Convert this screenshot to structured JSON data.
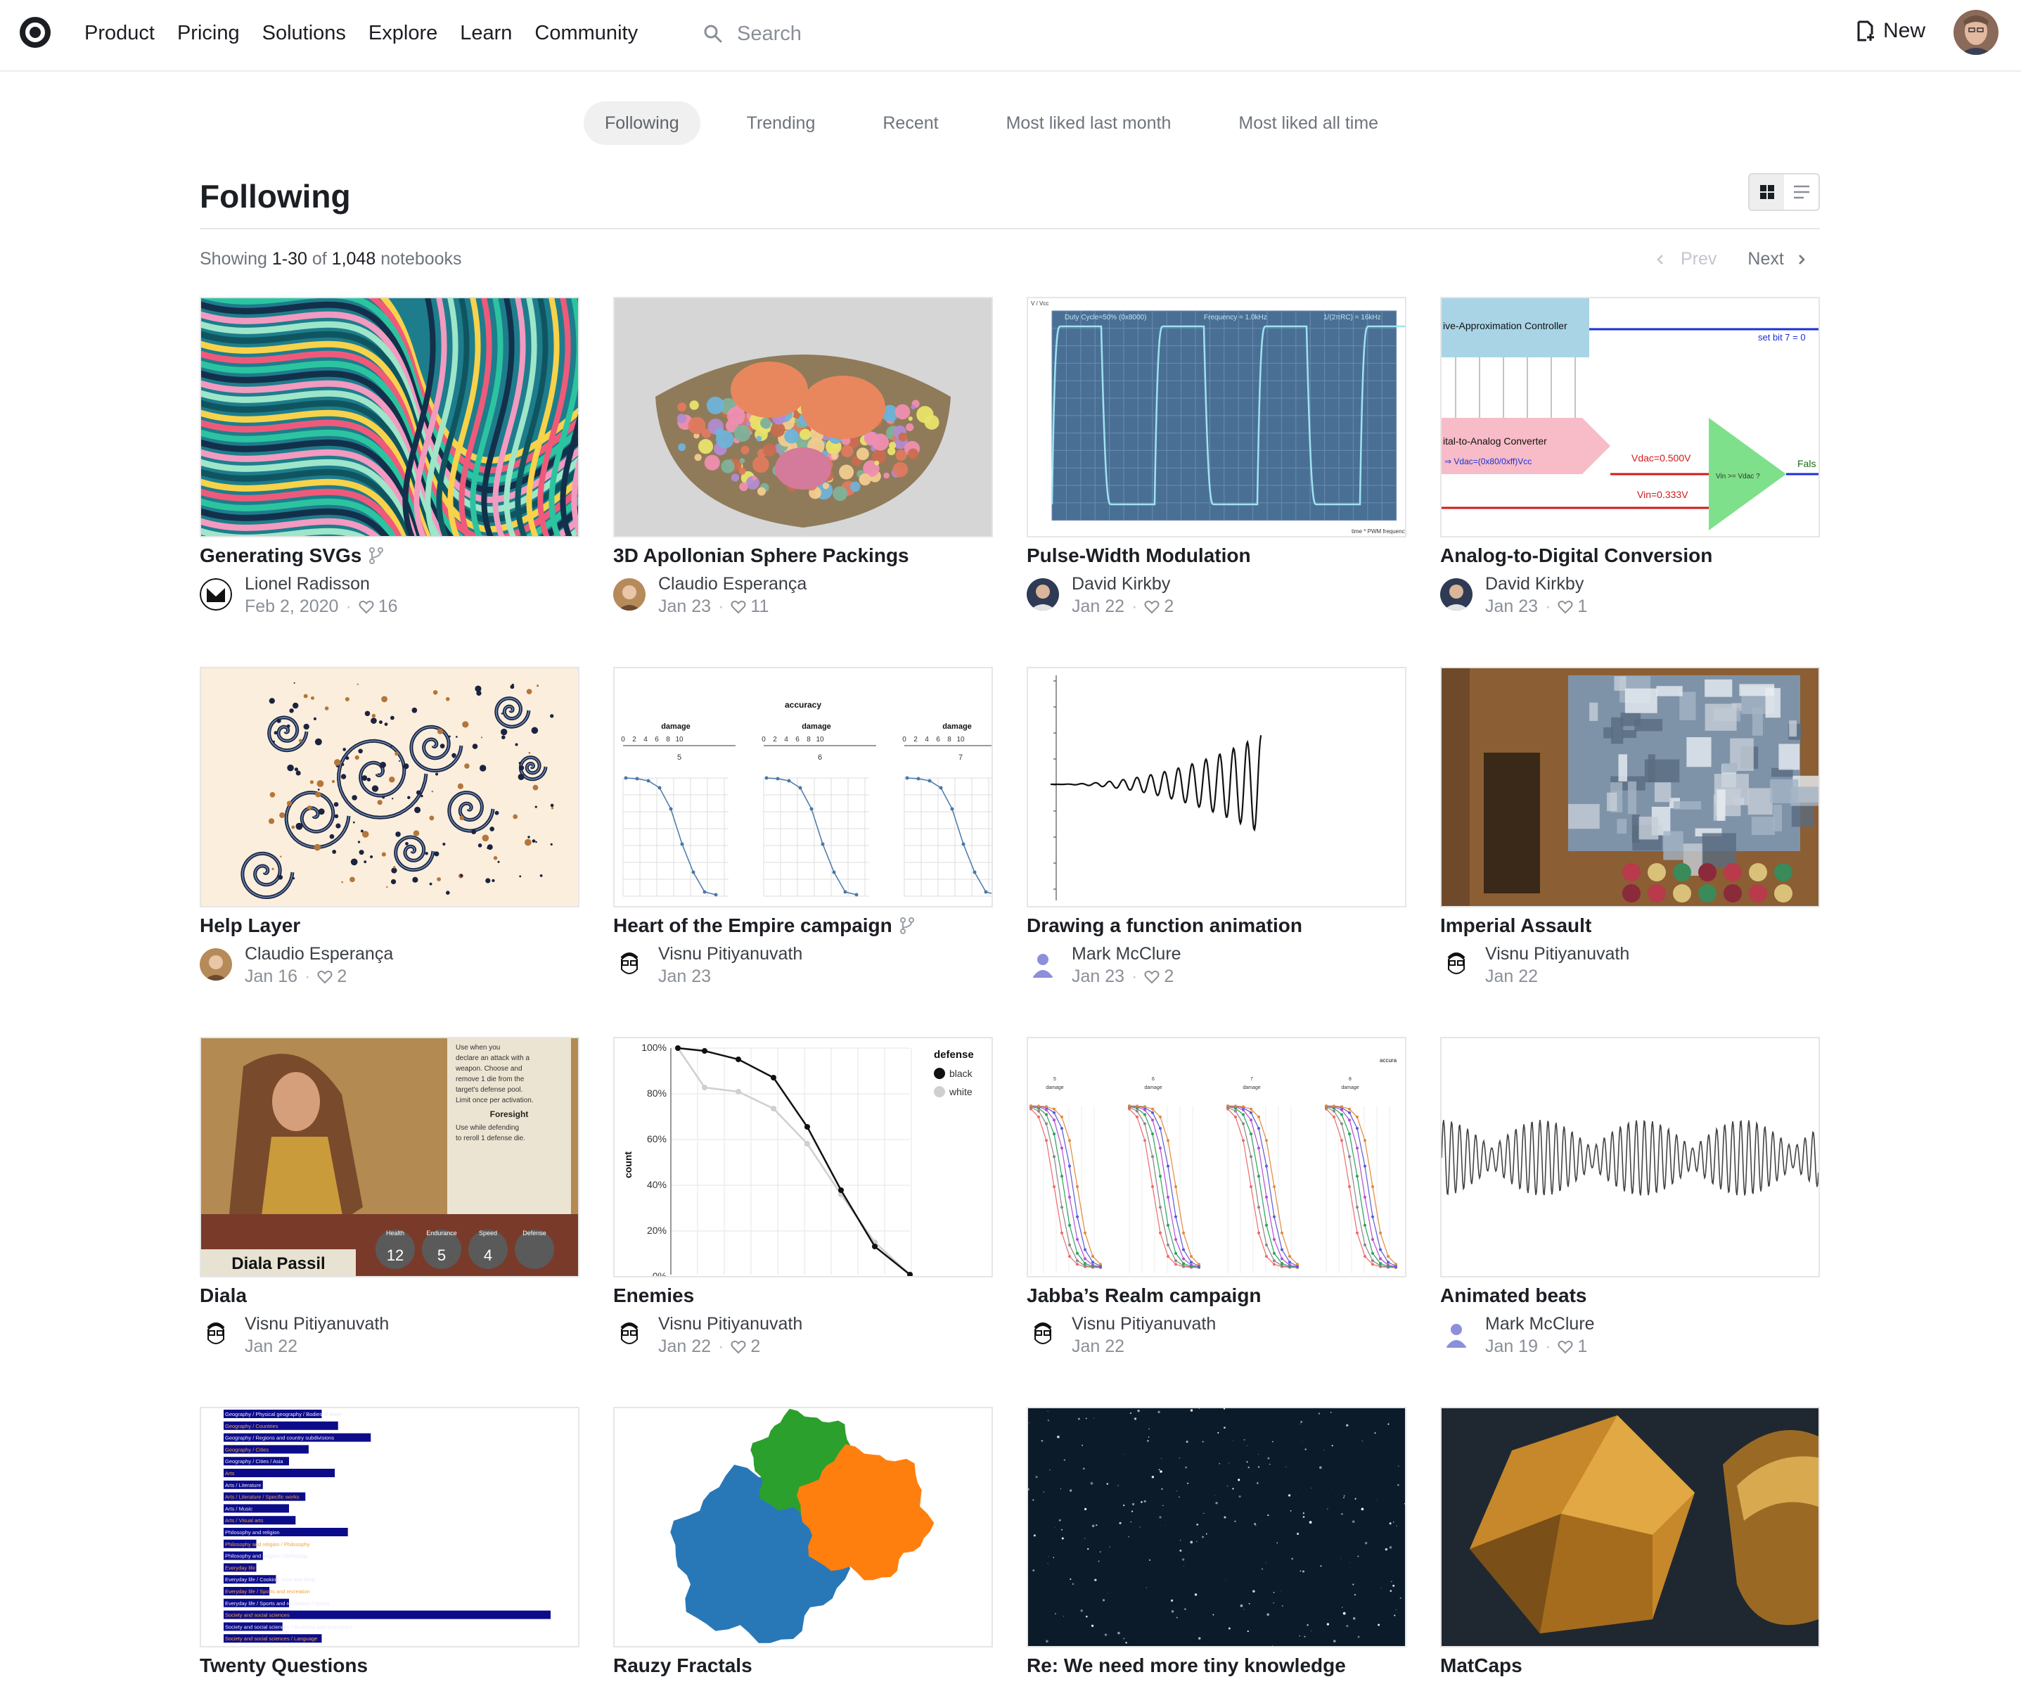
{
  "nav": {
    "items": [
      "Product",
      "Pricing",
      "Solutions",
      "Explore",
      "Learn",
      "Community"
    ],
    "search_placeholder": "Search",
    "new_label": "New"
  },
  "tabs": [
    "Following",
    "Trending",
    "Recent",
    "Most liked last month",
    "Most liked all time"
  ],
  "active_tab": "Following",
  "page_title": "Following",
  "showing": {
    "prefix": "Showing",
    "range": "1-30",
    "of": "of",
    "total": "1,048",
    "suffix": "notebooks"
  },
  "pager": {
    "prev": "Prev",
    "next": "Next"
  },
  "colors": {
    "accent": "#1b1e23",
    "muted": "#8a8f98",
    "thumb_border": "#e6e6e6"
  },
  "notebooks": [
    {
      "title": "Generating SVGs",
      "fork": true,
      "author": "Lionel Radisson",
      "date": "Feb 2, 2020",
      "likes": "16",
      "thumb": "swirl-art"
    },
    {
      "title": "3D Apollonian Sphere Packings",
      "fork": false,
      "author": "Claudio Esperança",
      "date": "Jan 23",
      "likes": "11",
      "thumb": "sphere-bowl"
    },
    {
      "title": "Pulse-Width Modulation",
      "fork": false,
      "author": "David Kirkby",
      "date": "Jan 22",
      "likes": "2",
      "thumb": "pwm-chart"
    },
    {
      "title": "Analog-to-Digital Conversion",
      "fork": false,
      "author": "David Kirkby",
      "date": "Jan 23",
      "likes": "1",
      "thumb": "adc-diagram"
    },
    {
      "title": "Help Layer",
      "fork": false,
      "author": "Claudio Esperança",
      "date": "Jan 16",
      "likes": "2",
      "thumb": "fractal-spiral"
    },
    {
      "title": "Heart of the Empire campaign",
      "fork": true,
      "author": "Visnu Pitiyanuvath",
      "date": "Jan 23",
      "likes": "",
      "thumb": "accuracy-curves"
    },
    {
      "title": "Drawing a function animation",
      "fork": false,
      "author": "Mark McClure",
      "date": "Jan 23",
      "likes": "2",
      "thumb": "wave-function"
    },
    {
      "title": "Imperial Assault",
      "fork": false,
      "author": "Visnu Pitiyanuvath",
      "date": "Jan 22",
      "likes": "",
      "thumb": "board-game"
    },
    {
      "title": "Diala",
      "fork": false,
      "author": "Visnu Pitiyanuvath",
      "date": "Jan 22",
      "likes": "",
      "thumb": "game-card"
    },
    {
      "title": "Enemies",
      "fork": false,
      "author": "Visnu Pitiyanuvath",
      "date": "Jan 22",
      "likes": "2",
      "thumb": "defense-chart"
    },
    {
      "title": "Jabba’s Realm campaign",
      "fork": false,
      "author": "Visnu Pitiyanuvath",
      "date": "Jan 22",
      "likes": "",
      "thumb": "multi-curves"
    },
    {
      "title": "Animated beats",
      "fork": false,
      "author": "Mark McClure",
      "date": "Jan 19",
      "likes": "1",
      "thumb": "beats-wave"
    },
    {
      "title": "Twenty Questions",
      "fork": false,
      "author": "",
      "date": "",
      "likes": "",
      "thumb": "bar-list"
    },
    {
      "title": "Rauzy Fractals",
      "fork": false,
      "author": "",
      "date": "",
      "likes": "",
      "thumb": "rauzy-fractal"
    },
    {
      "title": "Re: We need more tiny knowledge",
      "fork": false,
      "author": "",
      "date": "",
      "likes": "",
      "thumb": "starfield"
    },
    {
      "title": "MatCaps",
      "fork": false,
      "author": "",
      "date": "",
      "likes": "",
      "thumb": "matcap-shapes"
    }
  ],
  "thumb_text": {
    "pwm": {
      "top_left": "Duty Cycle=50% (0x8000)",
      "top_mid": "Frequency = 1.0kHz",
      "top_right": "1/(2πRC) = 16kHz",
      "x_label": "time * PWM frequency",
      "y_label": "V / Vcc"
    },
    "adc": {
      "controller": "ive-Approximation Controller",
      "set_bit": "set bit 7 = 0",
      "converter": "ital-to-Analog Converter",
      "vdac": "Vdac=0.500V",
      "formula": "⇒ Vdac=(0x80/0xff)Vcc",
      "vin": "Vin=0.333V",
      "compare": "Vin >= Vdac ?",
      "result": "Fals"
    },
    "accuracy": {
      "title": "accuracy",
      "axis": "damage",
      "panels": [
        "5",
        "6",
        "7"
      ]
    },
    "defense": {
      "legend_title": "defense",
      "legend": [
        "black",
        "white"
      ],
      "y_label": "count",
      "y_ticks": [
        "100%",
        "80%",
        "60%",
        "40%",
        "20%",
        "0%"
      ]
    },
    "diala": {
      "name": "Diala Passil",
      "text1": "Use when you declare an attack with a weapon. Choose and remove 1 die from the target's defense pool. Limit once per activation.",
      "foresight": "Foresight",
      "text2": "Use while defending to reroll 1 defense die.",
      "stats": [
        "Health",
        "Endurance",
        "Speed",
        "Defense"
      ],
      "values": [
        "12",
        "5",
        "4",
        ""
      ]
    },
    "jabba": {
      "label": "accura",
      "axis": "damage",
      "panels": [
        "5",
        "6",
        "7",
        "8"
      ]
    },
    "twenty": [
      "Geography / Physical geography / Bodies of water",
      "Geography / Countries",
      "Geography / Regions and country subdivisions",
      "Geography / Cities",
      "Geography / Cities / Asia",
      "Arts",
      "Arts / Literature",
      "Arts / Literature / Specific works",
      "Arts / Music",
      "Arts / Visual arts",
      "Philosophy and religion",
      "Philosophy and religion / Philosophy",
      "Philosophy and religion / Mythology",
      "Everyday life",
      "Everyday life / Cooking, food and drink",
      "Everyday life / Sports and recreation",
      "Everyday life / Sports and recreation / Sports",
      "Society and social sciences",
      "Society and social sciences / Business and economics",
      "Society and social sciences / Language"
    ],
    "twenty_values": [
      0.3,
      0.35,
      0.45,
      0.26,
      0.2,
      0.34,
      0.12,
      0.25,
      0.2,
      0.22,
      0.38,
      0.1,
      0.12,
      0.1,
      0.16,
      0.14,
      0.2,
      1.0,
      0.18,
      0.3
    ]
  }
}
